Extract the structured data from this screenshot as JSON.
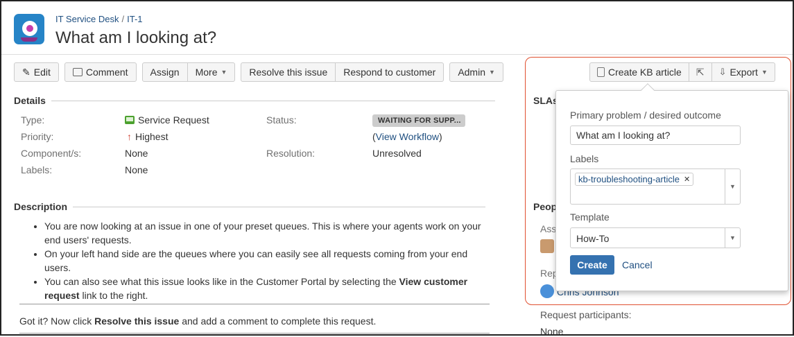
{
  "header": {
    "breadcrumb_project": "IT Service Desk",
    "breadcrumb_sep": "/",
    "breadcrumb_issue": "IT-1",
    "title": "What am I looking at?"
  },
  "toolbar": {
    "edit": "Edit",
    "comment": "Comment",
    "assign": "Assign",
    "more": "More",
    "resolve": "Resolve this issue",
    "respond": "Respond to customer",
    "admin": "Admin"
  },
  "details": {
    "heading": "Details",
    "type_label": "Type:",
    "type_value": "Service Request",
    "priority_label": "Priority:",
    "priority_value": "Highest",
    "component_label": "Component/s:",
    "component_value": "None",
    "labels_label": "Labels:",
    "labels_value": "None",
    "status_label": "Status:",
    "status_value": "WAITING FOR SUPP...",
    "workflow_open": "(",
    "workflow_link": "View Workflow",
    "workflow_close": ")",
    "resolution_label": "Resolution:",
    "resolution_value": "Unresolved"
  },
  "description": {
    "heading": "Description",
    "bullet1": "You are now looking at an issue in one of your preset queues. This is where your agents work on your end users' requests.",
    "bullet2": "On your left hand side are the queues where you can easily see all requests coming from your end users.",
    "bullet3_pre": "You can also see what this issue looks like in the Customer Portal by selecting the ",
    "bullet3_bold": "View customer request",
    "bullet3_post": " link to the right.",
    "footer_pre": "Got it? Now click ",
    "footer_bold": "Resolve this issue",
    "footer_post": " and add a comment to complete this request."
  },
  "side": {
    "create_kb": "Create KB article",
    "export": "Export",
    "slas_heading": "SLAs",
    "people_heading": "Peop",
    "assignee_label": "Ass",
    "reporter_label": "Rep",
    "reporter_name": "Chris Johnson",
    "participants_label": "Request participants:",
    "participants_value": "None"
  },
  "popover": {
    "problem_label": "Primary problem / desired outcome",
    "problem_value": "What am I looking at?",
    "labels_label": "Labels",
    "label_tag": "kb-troubleshooting-article",
    "template_label": "Template",
    "template_value": "How-To",
    "create": "Create",
    "cancel": "Cancel"
  },
  "colors": {
    "link": "#205081",
    "primary_button": "#3572b0",
    "highlight_border": "#e05030",
    "priority_highest": "#d04437"
  }
}
